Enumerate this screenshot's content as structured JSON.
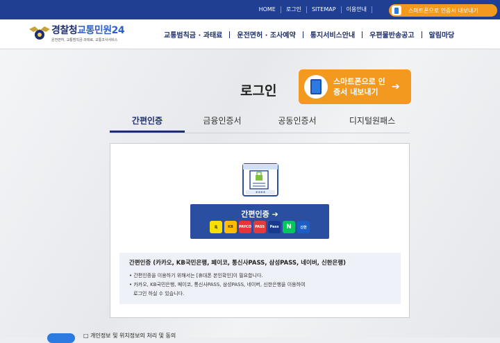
{
  "top_links": [
    "HOME",
    "로그인",
    "SITEMAP",
    "이용안내"
  ],
  "top_red_link": "",
  "smart_pill": "스마트폰으로 인증서 내보내기",
  "logo": {
    "main_a": "경찰청",
    "main_b": "교통민원24",
    "sub": "운전면허, 교통범칙금·과태료, 교통조사서비스"
  },
  "main_nav": [
    "교통범칙금 · 과태료",
    "운전면허 · 조사예약",
    "통지서비스안내",
    "우편물반송공고",
    "알림마당"
  ],
  "page_title": "로그인",
  "send_banner": {
    "text": "스마트폰으로 인증서 내보내기",
    "arrow": "➔"
  },
  "tabs": [
    "간편인증",
    "금융인증서",
    "공동인증서",
    "디지털원패스"
  ],
  "active_tab": "간편인증",
  "easy_button": {
    "label": "간편인증 ➔"
  },
  "providers": [
    {
      "name": "kakao",
      "label": "톡",
      "color": "#f7e000"
    },
    {
      "name": "kb",
      "label": "KB",
      "color": "#ffbc00"
    },
    {
      "name": "payco",
      "label": "PAYCO",
      "color": "#e8333a"
    },
    {
      "name": "pass",
      "label": "PASS",
      "color": "#e63a3a"
    },
    {
      "name": "samsung-pass",
      "label": "Pass",
      "color": "#1a3a8f"
    },
    {
      "name": "naver",
      "label": "N",
      "color": "#03c75a"
    },
    {
      "name": "shinhan",
      "label": "신한",
      "color": "#1b5ec6"
    }
  ],
  "info": {
    "head": "간편인증 (카카오, KB국민은행, 페이코, 통신사PASS, 삼성PASS, 네이버, 신한은행)",
    "line1": "• 간편인증을 이용하기 위해서는 [휴대폰 본인확인]이 필요합니다.",
    "line2": "• 카카오, KB국민은행, 페이코, 통신사PASS, 삼성PASS, 네이버, 신한은행을 이용하여",
    "line3": "로그인 하실 수 있습니다."
  },
  "bottom_text": "□ 개인정보 및 위치정보의 처리 및 동의"
}
